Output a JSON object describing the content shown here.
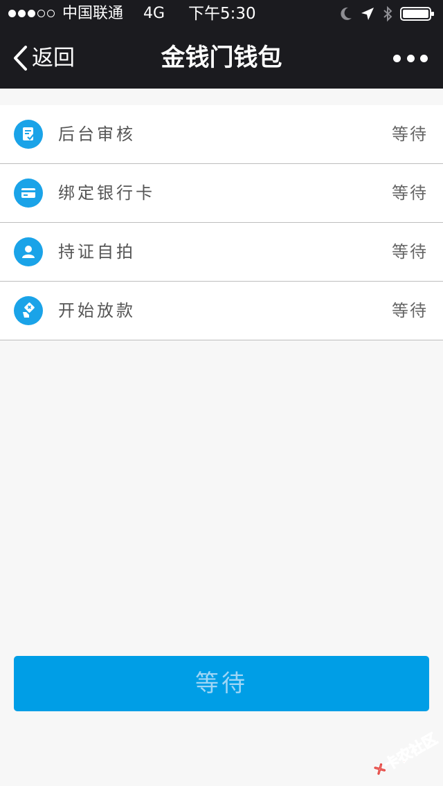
{
  "status_bar": {
    "carrier": "中国联通",
    "network": "4G",
    "time": "下午5:30",
    "signal_bars_filled": 3,
    "signal_bars_total": 5,
    "icons": [
      "moon-icon",
      "location-arrow-icon",
      "bluetooth-icon",
      "battery-icon"
    ]
  },
  "nav": {
    "back_label": "返回",
    "title": "金钱门钱包",
    "back_icon": "chevron-left-icon",
    "more_icon": "more-dots-icon"
  },
  "steps": [
    {
      "icon": "review-document-icon",
      "label": "后台审核",
      "status": "等待"
    },
    {
      "icon": "bank-card-icon",
      "label": "绑定银行卡",
      "status": "等待"
    },
    {
      "icon": "user-icon",
      "label": "持证自拍",
      "status": "等待"
    },
    {
      "icon": "payout-icon",
      "label": "开始放款",
      "status": "等待"
    }
  ],
  "action_button": {
    "label": "等待"
  },
  "watermark": {
    "text": "卡农社区"
  },
  "colors": {
    "nav_background": "#1b1b1f",
    "accent": "#009ee6",
    "icon_blue": "#1aa3e8",
    "page_background": "#f7f7f7",
    "watermark_red": "#e3342f"
  }
}
